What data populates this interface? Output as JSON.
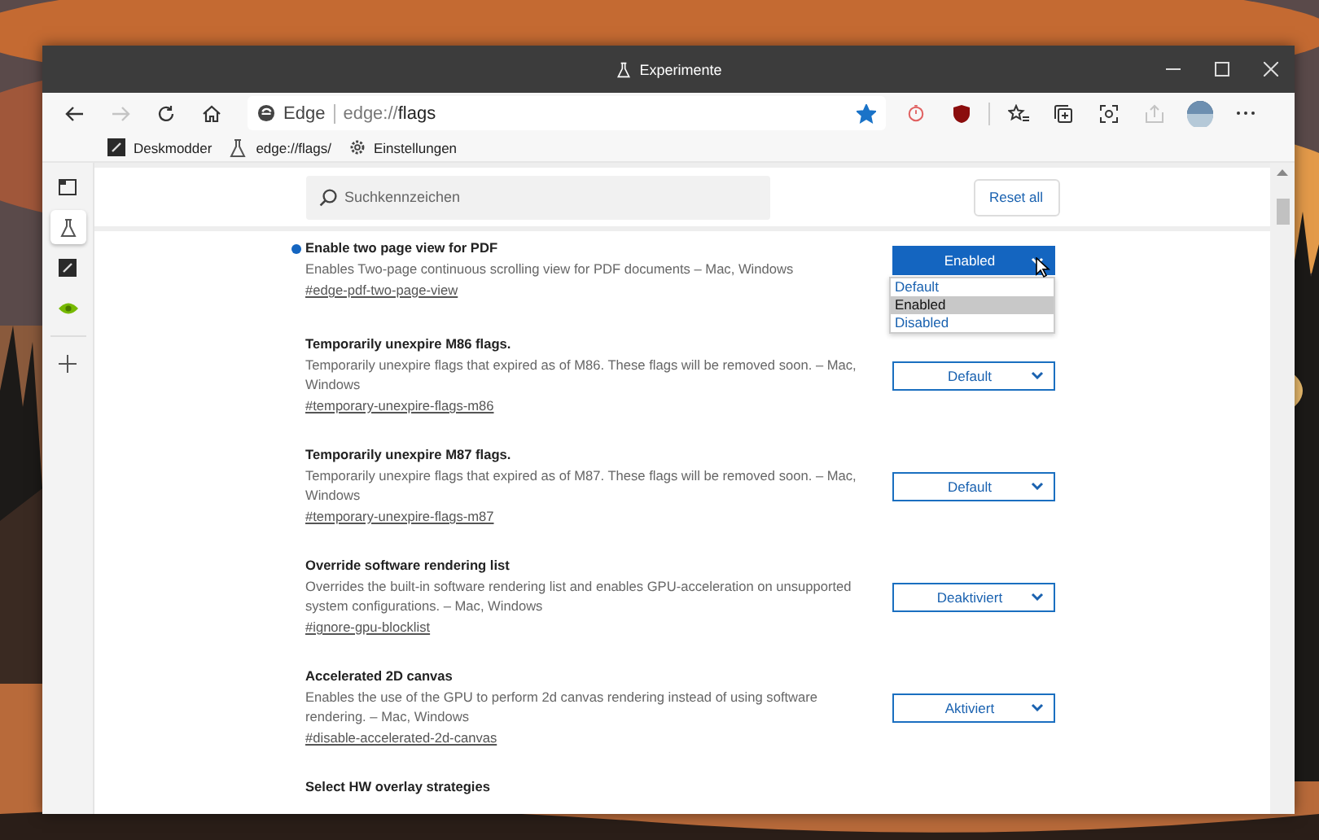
{
  "window": {
    "title": "Experimente"
  },
  "toolbar": {
    "forward_disabled": true,
    "site_label": "Edge",
    "url_scheme": "edge://",
    "url_path": "flags",
    "favorited": true
  },
  "bookmarks": [
    {
      "kind": "deskmodder",
      "label": "Deskmodder"
    },
    {
      "kind": "flask",
      "label": "edge://flags/"
    },
    {
      "kind": "gear",
      "label": "Einstellungen"
    }
  ],
  "sidebar": {
    "items": [
      {
        "kind": "flask",
        "selected": true
      },
      {
        "kind": "deskmodder",
        "selected": false
      },
      {
        "kind": "nvidia",
        "selected": false
      }
    ]
  },
  "search": {
    "placeholder": "Suchkennzeichen"
  },
  "reset_button": "Reset all",
  "flags": [
    {
      "title": "Enable two page view for PDF",
      "description": "Enables Two-page continuous scrolling view for PDF documents – Mac, Windows",
      "link": "#edge-pdf-two-page-view",
      "value": "Enabled",
      "modified": true,
      "expanded": true,
      "options": [
        {
          "label": "Default",
          "selected": false
        },
        {
          "label": "Enabled",
          "selected": true
        },
        {
          "label": "Disabled",
          "selected": false
        }
      ]
    },
    {
      "title": "Temporarily unexpire M86 flags.",
      "description": "Temporarily unexpire flags that expired as of M86. These flags will be removed soon. – Mac, Windows",
      "link": "#temporary-unexpire-flags-m86",
      "value": "Default",
      "modified": false,
      "expanded": false
    },
    {
      "title": "Temporarily unexpire M87 flags.",
      "description": "Temporarily unexpire flags that expired as of M87. These flags will be removed soon. – Mac, Windows",
      "link": "#temporary-unexpire-flags-m87",
      "value": "Default",
      "modified": false,
      "expanded": false
    },
    {
      "title": "Override software rendering list",
      "description": "Overrides the built-in software rendering list and enables GPU-acceleration on unsupported system configurations. – Mac, Windows",
      "link": "#ignore-gpu-blocklist",
      "value": "Deaktiviert",
      "modified": false,
      "expanded": false
    },
    {
      "title": "Accelerated 2D canvas",
      "description": "Enables the use of the GPU to perform 2d canvas rendering instead of using software rendering. – Mac, Windows",
      "link": "#disable-accelerated-2d-canvas",
      "value": "Aktiviert",
      "modified": false,
      "expanded": false
    }
  ],
  "next_flag_title": "Select HW overlay strategies"
}
